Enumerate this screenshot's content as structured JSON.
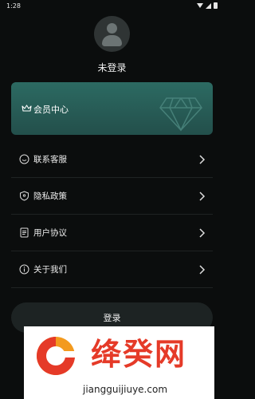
{
  "status_bar": {
    "time": "1:28"
  },
  "profile": {
    "login_status": "未登录"
  },
  "vip_card": {
    "label": "会员中心"
  },
  "menu": {
    "items": [
      {
        "label": "联系客服"
      },
      {
        "label": "隐私政策"
      },
      {
        "label": "用户协议"
      },
      {
        "label": "关于我们"
      }
    ]
  },
  "login_button": {
    "label": "登录"
  },
  "watermark": {
    "title": "绛癸网",
    "url": "jiangguijiuye.com"
  },
  "colors": {
    "background": "#0b0d0d",
    "vip_card": "#2c6a62",
    "button": "#1d2323",
    "watermark_red": "#e53a28"
  }
}
